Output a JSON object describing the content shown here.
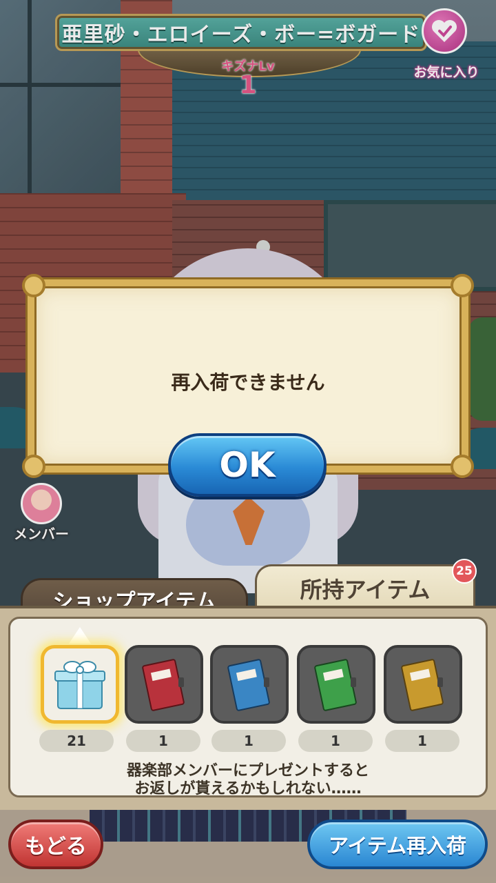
{
  "header": {
    "character_name": "亜里砂・エロイーズ・ボー=ボガード",
    "kizuna_label": "キズナLv",
    "kizuna_level": "1",
    "favorite_label": "お気に入り"
  },
  "side": {
    "member_label": "メンバー"
  },
  "dialog": {
    "message": "再入荷できません",
    "ok_label": "OK"
  },
  "tabs": {
    "shop_label": "ショップアイテム",
    "owned_label": "所持アイテム",
    "owned_badge": "25"
  },
  "items": [
    {
      "icon": "gift-box-icon",
      "count": "21",
      "selected": true
    },
    {
      "icon": "red-report-book-icon",
      "count": "1",
      "color": "#b8323c"
    },
    {
      "icon": "blue-report-book-icon",
      "count": "1",
      "color": "#3a86c4"
    },
    {
      "icon": "green-report-book-icon",
      "count": "1",
      "color": "#3ea04a"
    },
    {
      "icon": "yellow-report-book-icon",
      "count": "1",
      "color": "#c89a2e"
    }
  ],
  "hint": {
    "line1": "器楽部メンバーにプレゼントすると",
    "line2": "お返しが貰えるかもしれない……"
  },
  "buttons": {
    "back_label": "もどる",
    "restock_label": "アイテム再入荷"
  },
  "colors": {
    "ok_button": "#2a8ad6",
    "back_button": "#c03432",
    "favorite": "#d04a9c",
    "dialog_border": "#d8b25a"
  }
}
